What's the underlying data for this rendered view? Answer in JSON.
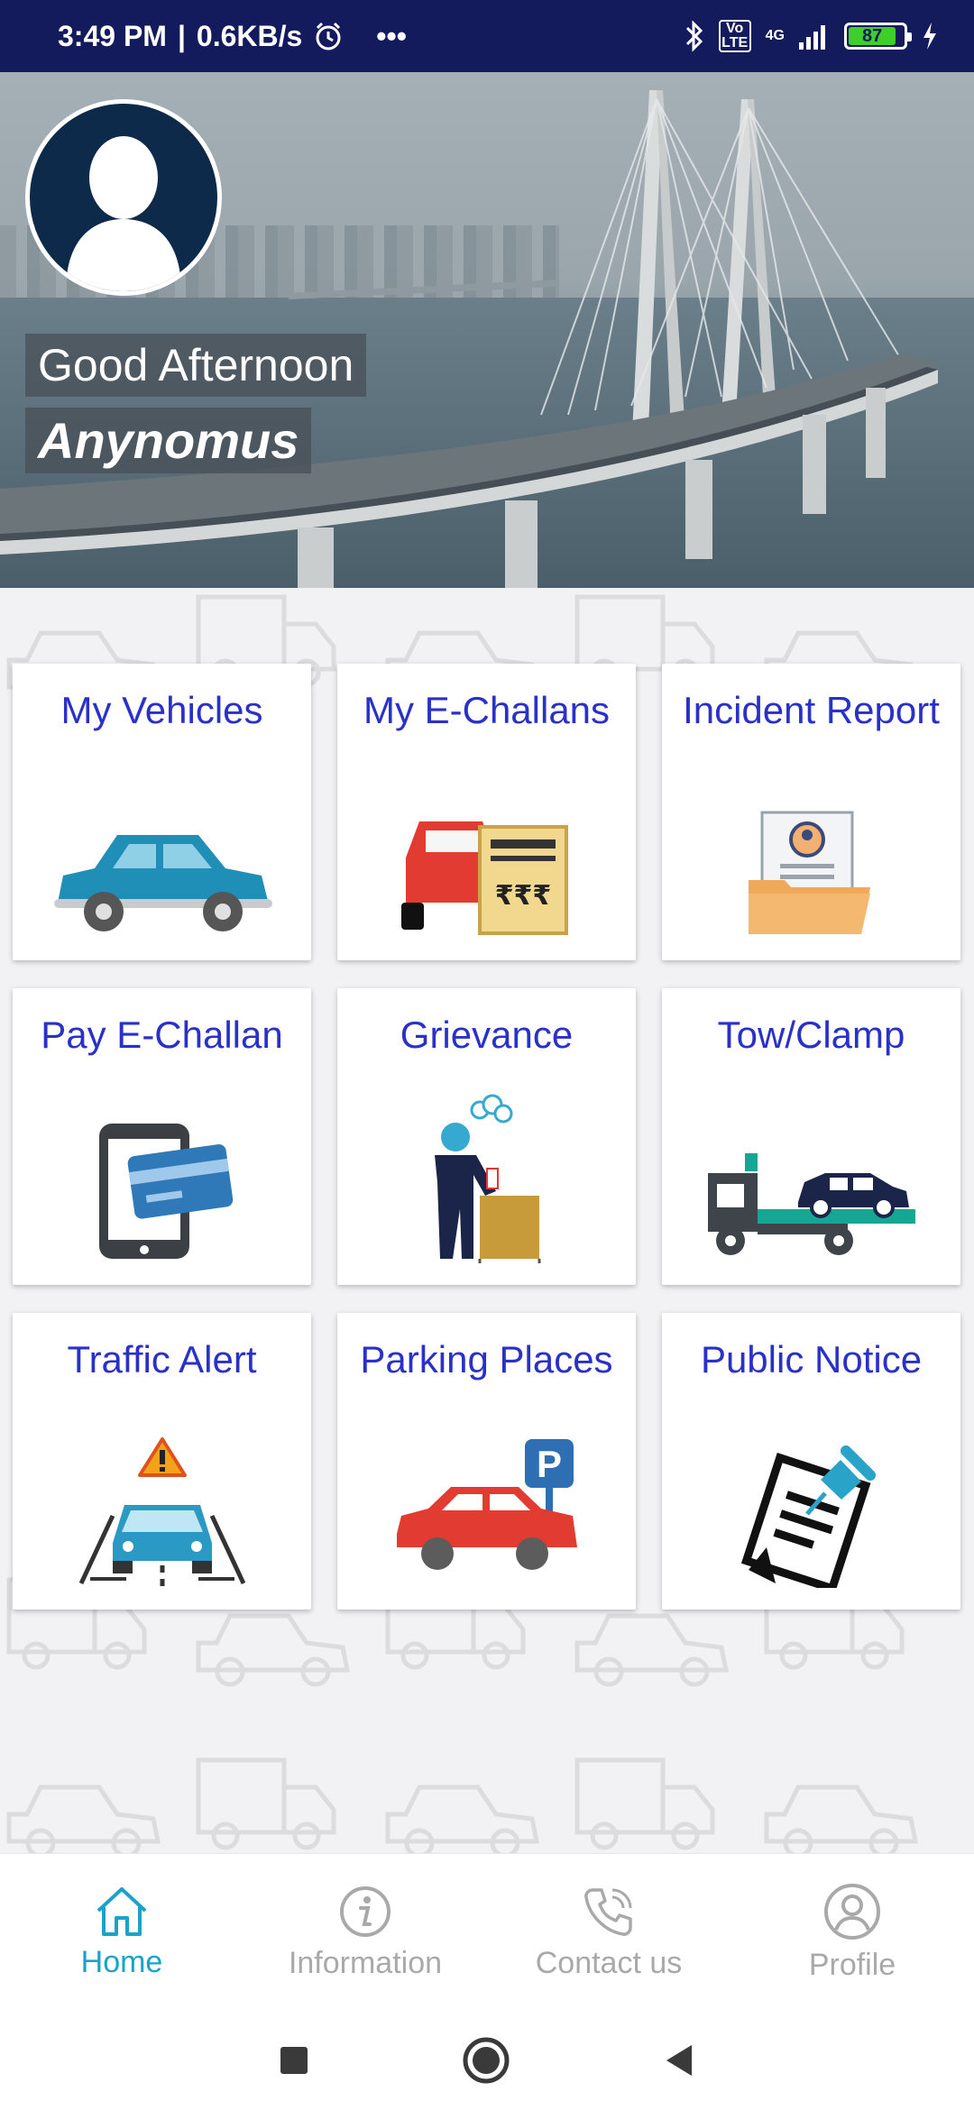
{
  "status_bar": {
    "time": "3:49 PM",
    "separator": "|",
    "speed": "0.6KB/s",
    "alarm_icon": "alarm-icon",
    "more": "•••",
    "volte": "Vo LTE",
    "network": "4G",
    "battery": "87"
  },
  "header": {
    "greeting": "Good Afternoon",
    "user_name": "Anynomus"
  },
  "tiles": [
    {
      "label": "My Vehicles",
      "icon": "car-icon"
    },
    {
      "label": "My E-Challans",
      "icon": "echallan-icon"
    },
    {
      "label": "Incident Report",
      "icon": "incident-folder-icon"
    },
    {
      "label": "Pay E-Challan",
      "icon": "phone-card-icon"
    },
    {
      "label": "Grievance",
      "icon": "grievance-icon"
    },
    {
      "label": "Tow/Clamp",
      "icon": "tow-truck-icon"
    },
    {
      "label": "Traffic Alert",
      "icon": "traffic-alert-icon"
    },
    {
      "label": "Parking Places",
      "icon": "parking-icon"
    },
    {
      "label": "Public Notice",
      "icon": "notice-icon"
    }
  ],
  "bottom_nav": [
    {
      "label": "Home",
      "icon": "home-icon",
      "active": true
    },
    {
      "label": "Information",
      "icon": "info-icon",
      "active": false
    },
    {
      "label": "Contact us",
      "icon": "phone-icon",
      "active": false
    },
    {
      "label": "Profile",
      "icon": "profile-icon",
      "active": false
    }
  ],
  "colors": {
    "status_bar": "#131b5c",
    "tile_label": "#2a31c9",
    "nav_active": "#1aa3c9",
    "nav_inactive": "#a9a9a9"
  }
}
